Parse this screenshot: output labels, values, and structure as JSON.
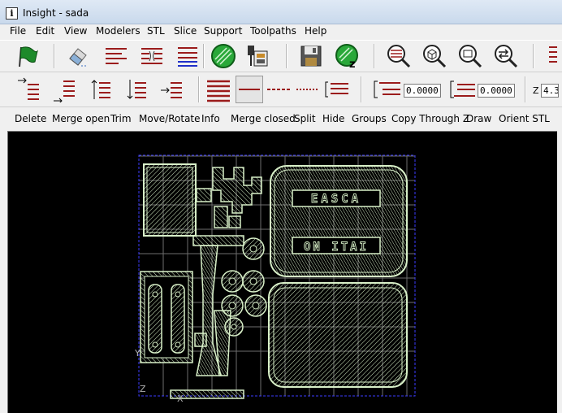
{
  "window": {
    "title": "Insight - sada",
    "icon": "info-icon"
  },
  "menu": [
    "File",
    "Edit",
    "View",
    "Modelers",
    "STL",
    "Slice",
    "Support",
    "Toolpaths",
    "Help"
  ],
  "toolbar1": {
    "buttons": [
      "green-flag-icon",
      "eraser-icon",
      "lines-icon",
      "lines-split-icon",
      "lines-blue-icon",
      "green-hatch-icon",
      "machine-icon",
      "save-icon",
      "green-hatch-z-icon",
      "zoom-lines-icon",
      "zoom-cube-icon",
      "zoom-fit-icon",
      "zoom-swap-icon"
    ]
  },
  "toolbar2": {
    "buttons": [
      "arrow-right-top-icon",
      "arrow-right-bottom-icon",
      "arrow-up-icon",
      "arrow-down-icon",
      "arrow-right-middle-icon",
      "thick-lines-icon",
      "single-line-icon",
      "dashed-line-icon",
      "dotted-line-icon",
      "bracket-lines-icon"
    ],
    "offset_top_value": "0.0000",
    "offset_bottom_value": "0.0000",
    "z_label": "Z",
    "z_value": "4.3"
  },
  "commands": [
    "Delete",
    "Merge open",
    "Trim",
    "Move/Rotate",
    "Info",
    "Merge closed",
    "Split",
    "Hide",
    "Groups",
    "Copy Through Z",
    "Draw",
    "Orient STL"
  ],
  "viewport": {
    "axis_y_label": "Y",
    "axis_z_label": "Z",
    "axis_x_label": "X",
    "part_text_top": "EASCA",
    "part_text_bottom": "ON ITAI",
    "colors": {
      "background": "#000000",
      "bbox": "#3b3bff",
      "grid": "#7a7a7a",
      "part": "#d8f0c8"
    }
  }
}
